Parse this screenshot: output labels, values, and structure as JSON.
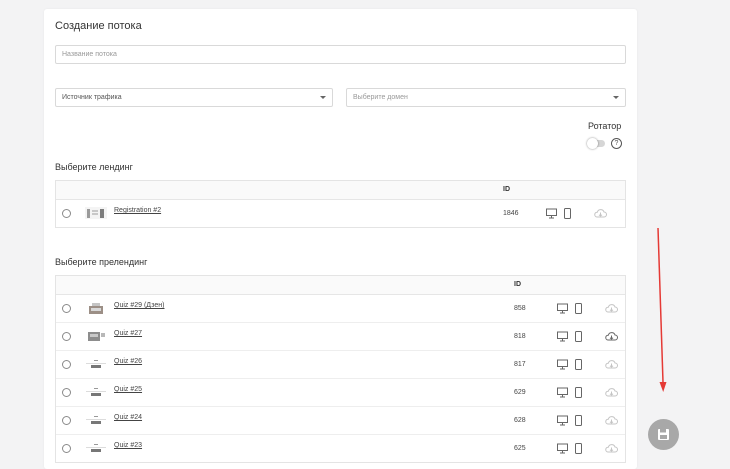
{
  "form": {
    "title": "Создание потока",
    "stream_name_placeholder": "Название потока",
    "traffic_source": "Источник трафика",
    "domain_placeholder": "Выберите домен",
    "rotator_label": "Ротатор",
    "help_glyph": "?"
  },
  "landing": {
    "section_title": "Выберите лендинг",
    "id_header": "ID",
    "rows": [
      {
        "name": "Registration #2",
        "id": "1846",
        "cloud": "cloud-download-icon"
      }
    ]
  },
  "prelanding": {
    "section_title": "Выберите прелендинг",
    "id_header": "ID",
    "rows": [
      {
        "name": "Quiz #29 (Дзен)",
        "id": "858"
      },
      {
        "name": "Quiz #27",
        "id": "818"
      },
      {
        "name": "Quiz #26",
        "id": "817"
      },
      {
        "name": "Quiz #25",
        "id": "629"
      },
      {
        "name": "Quiz #24",
        "id": "628"
      },
      {
        "name": "Quiz #23",
        "id": "625"
      }
    ]
  },
  "colors": {
    "annotation_arrow": "#e53935",
    "fab": "#a8a8a8"
  }
}
